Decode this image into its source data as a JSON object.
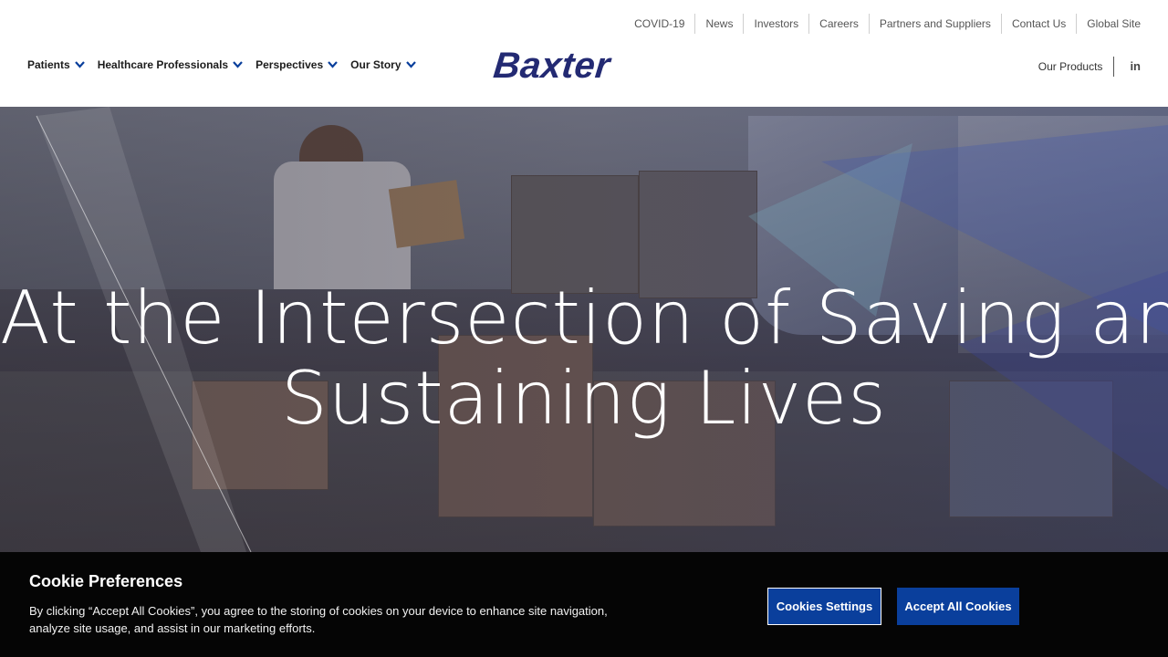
{
  "header": {
    "utility_links": [
      "COVID-19",
      "News",
      "Investors",
      "Careers",
      "Partners and Suppliers",
      "Contact Us",
      "Global Site"
    ],
    "main_nav": [
      {
        "label": "Patients",
        "icon": "chevron-down-icon"
      },
      {
        "label": "Healthcare Professionals",
        "icon": "chevron-down-icon"
      },
      {
        "label": "Perspectives",
        "icon": "chevron-down-icon"
      },
      {
        "label": "Our Story",
        "icon": "chevron-down-icon"
      }
    ],
    "logo_text": "Baxter",
    "our_products": "Our Products",
    "linkedin_glyph": "in",
    "accent_color": "#0a3f9c",
    "logo_color": "#232a73"
  },
  "hero": {
    "title_line1": "At the Intersection of Saving and",
    "title_line2": "Sustaining Lives"
  },
  "cookie_banner": {
    "title": "Cookie Preferences",
    "text": "By clicking “Accept All Cookies”, you agree to the storing of cookies on your device to enhance site navigation, analyze site usage, and assist in our marketing efforts.",
    "settings_label": "Cookies Settings",
    "accept_label": "Accept All Cookies",
    "button_color": "#0a3f9c"
  }
}
